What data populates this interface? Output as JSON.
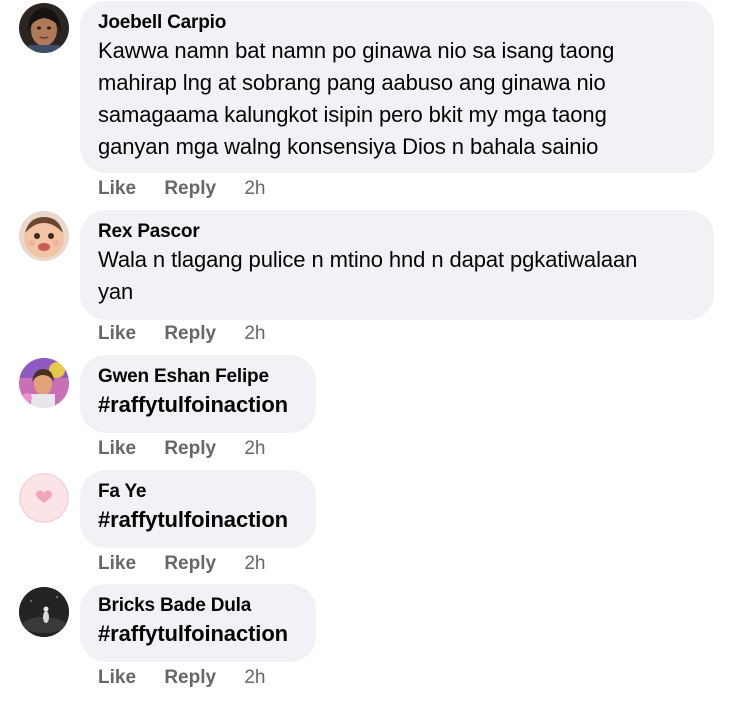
{
  "actions": {
    "like_label": "Like",
    "reply_label": "Reply"
  },
  "comments": [
    {
      "author": "Joebell Carpio",
      "lines": [
        "Kawwa namn bat namn po ginawa nio sa isang taong",
        "mahirap lng at sobrang pang aabuso ang ginawa nio",
        "samagaama kalungkot isipin pero bkit my mga taong",
        "ganyan mga walng konsensiya Dios n bahala sainio"
      ],
      "time": "2h"
    },
    {
      "author": "Rex Pascor",
      "lines": [
        "Wala n tlagang pulice n mtino hnd n dapat pgkatiwalaan",
        "yan"
      ],
      "time": "2h"
    },
    {
      "author": "Gwen Eshan Felipe",
      "lines": [
        "#raffytulfoinaction"
      ],
      "time": "2h"
    },
    {
      "author": "Fa Ye",
      "lines": [
        "#raffytulfoinaction"
      ],
      "time": "2h"
    },
    {
      "author": "Bricks Bade Dula",
      "lines": [
        "#raffytulfoinaction"
      ],
      "time": "2h"
    }
  ],
  "colors": {
    "bubble_bg": "#f0f2f5",
    "meta_text": "#65676b",
    "primary_text": "#050505"
  }
}
